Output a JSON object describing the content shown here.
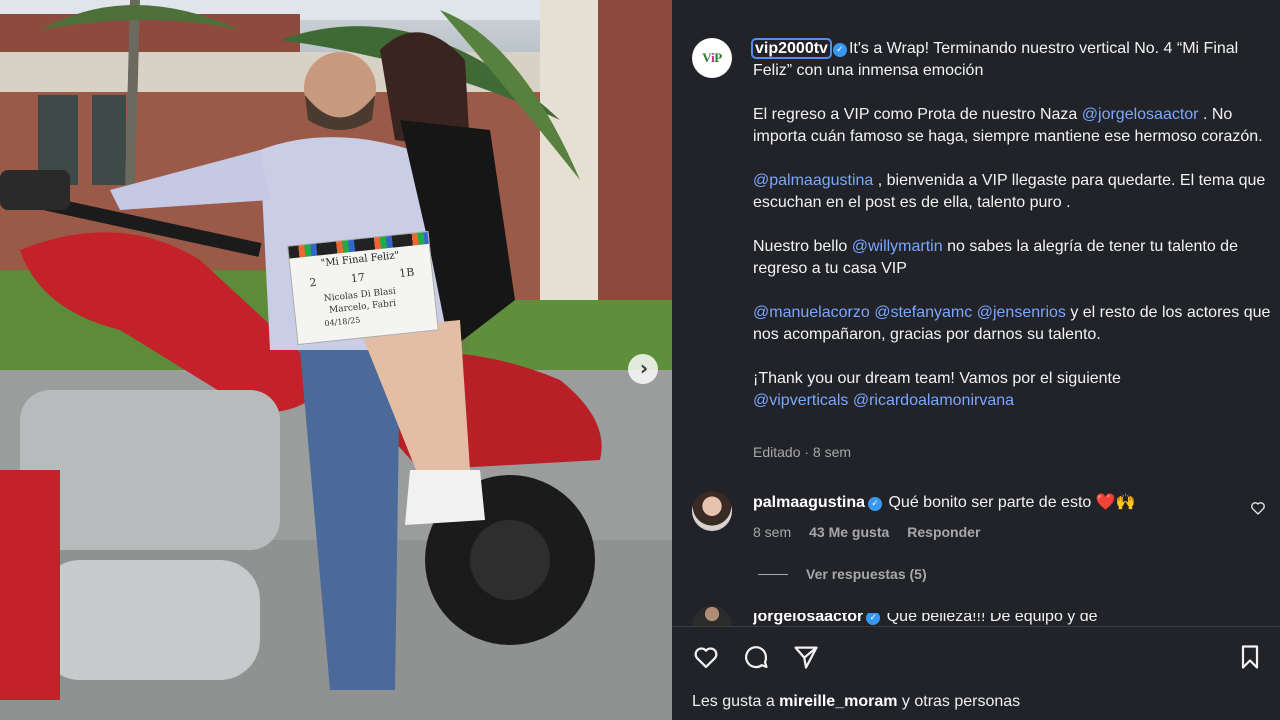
{
  "photo": {
    "clapper": {
      "title": "\"Mi Final Feliz\"",
      "roll": "2",
      "scene": "17",
      "take": "1B",
      "director": "Nicolas Di Blasi",
      "camera": "Marcelo, Fabri",
      "date": "04/18/25"
    },
    "next_icon": "chevron-right-icon"
  },
  "post": {
    "author": "vip2000tv",
    "caption_intro": "It's a Wrap! Terminando nuestro vertical No. 4 “Mi Final Feliz” con una inmensa emoción",
    "para2_text": "El regreso a VIP como Prota de nuestro Naza ",
    "para2_mention": "@jorgelosaactor",
    "para2_rest": " . No importa cuán famoso se haga, siempre mantiene ese hermoso corazón.",
    "para3_mention": "@palmaagustina",
    "para3_rest": " , bienvenida a VIP llegaste para quedarte. El tema que escuchan en el post es de ella, talento puro .",
    "para4_text": "Nuestro bello ",
    "para4_mention": "@willymartin",
    "para4_rest": " no sabes la alegría de tener tu talento de regreso a tu casa VIP",
    "para5_mentions": [
      "@manuelacorzo",
      "@stefanyamc",
      "@jensenrios"
    ],
    "para5_rest": " y el resto de los actores que nos acompañaron, gracias por darnos su talento.",
    "para6_text": "¡Thank you our dream team! Vamos por el siguiente",
    "para6_mentions": [
      "@vipverticals",
      "@ricardoalamonirvana"
    ],
    "meta": "Editado · 8 sem"
  },
  "comments": [
    {
      "user": "palmaagustina",
      "text": "Qué bonito ser parte de esto ❤️🙌",
      "time": "8 sem",
      "likes": "43 Me gusta",
      "reply": "Responder",
      "view_replies": "Ver respuestas (5)"
    },
    {
      "user": "jorgelosaactor",
      "text": "Que belleza!!! De equipo y de"
    }
  ],
  "footer": {
    "likes_prefix": "Les gusta a ",
    "likes_user": "mireille_moram",
    "likes_suffix": " y otras personas"
  },
  "icons": [
    "heart-icon",
    "comment-icon",
    "share-icon",
    "bookmark-icon",
    "verified-badge-icon"
  ]
}
